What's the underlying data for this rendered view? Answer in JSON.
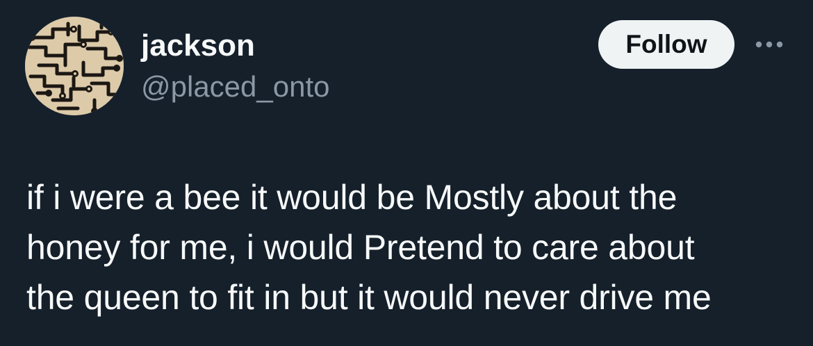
{
  "author": {
    "display_name": "jackson",
    "handle": "@placed_onto",
    "avatar_description": "circuit-pattern-avatar"
  },
  "actions": {
    "follow_label": "Follow",
    "more_icon": "more-horizontal-icon"
  },
  "tweet": {
    "text": "if i were a bee it would be Mostly about the\nhoney for me, i would Pretend to care about\nthe queen to fit in but it would never drive me"
  },
  "colors": {
    "background": "#15202b",
    "primary_text": "#f7f9f9",
    "secondary_text": "#8b98a5",
    "follow_bg": "#eff3f4",
    "follow_text": "#0f1419"
  }
}
